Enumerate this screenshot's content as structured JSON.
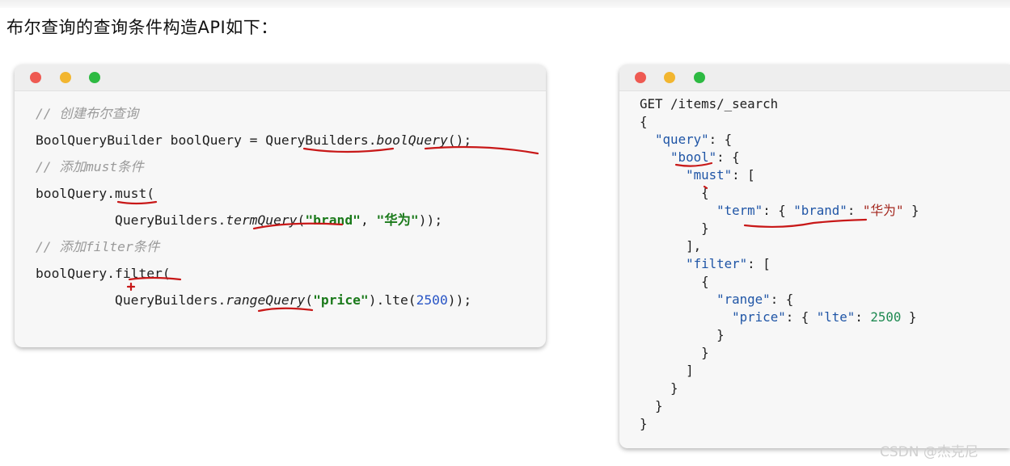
{
  "heading": "布尔查询的查询条件构造API如下：",
  "java_code": {
    "comment_create": "// 创建布尔查询",
    "line_builder": {
      "type": "BoolQueryBuilder",
      "var": " boolQuery = ",
      "factory": "QueryBuilders",
      "dot": ".",
      "method": "boolQuery",
      "end": "();"
    },
    "comment_must": "// 添加must条件",
    "line_must": {
      "obj": "boolQuery.",
      "method": "must",
      "end": "("
    },
    "line_term": {
      "indent": "          ",
      "factory": "QueryBuilders.",
      "method": "termQuery",
      "open": "(",
      "arg1": "\"brand\"",
      "sep": ", ",
      "arg2": "\"华为\"",
      "end": "));"
    },
    "comment_filter": "// 添加filter条件",
    "line_filter": {
      "obj": "boolQuery.",
      "method": "filter",
      "end": "("
    },
    "line_range": {
      "indent": "          ",
      "factory": "QueryBuilders.",
      "method": "rangeQuery",
      "open": "(",
      "arg": "\"price\"",
      "mid": ").lte(",
      "num": "2500",
      "end": "));"
    }
  },
  "dsl_code": {
    "request_line": "GET /items/_search",
    "k_query": "\"query\"",
    "k_bool": "\"bool\"",
    "k_must": "\"must\"",
    "k_term": "\"term\"",
    "k_brand": "\"brand\"",
    "v_brand": "\"华为\"",
    "k_filter": "\"filter\"",
    "k_range": "\"range\"",
    "k_price": "\"price\"",
    "k_lte": "\"lte\"",
    "v_lte": "2500"
  },
  "watermark": "CSDN @杰克尼",
  "colors": {
    "annotation_ink": "#c81818",
    "dot_red": "#ee5a52",
    "dot_yellow": "#f2b630",
    "dot_green": "#2dba42"
  }
}
